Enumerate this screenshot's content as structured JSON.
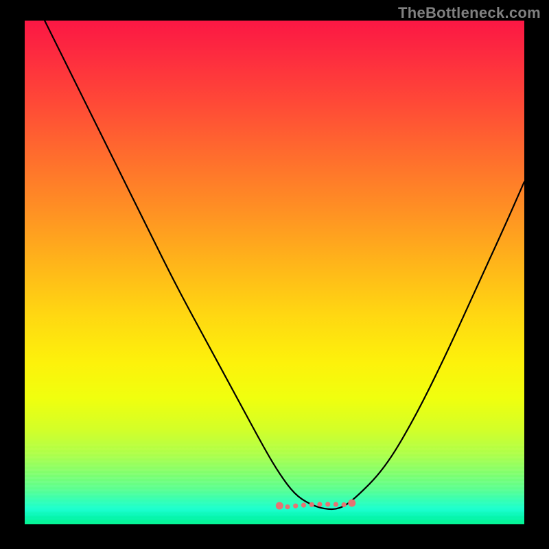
{
  "watermark": "TheBottleneck.com",
  "chart_data": {
    "type": "line",
    "title": "",
    "xlabel": "",
    "ylabel": "",
    "xlim": [
      0,
      100
    ],
    "ylim": [
      0,
      100
    ],
    "grid": false,
    "legend": false,
    "series": [
      {
        "name": "bottleneck-curve",
        "x": [
          0,
          6,
          12,
          18,
          24,
          30,
          36,
          42,
          48,
          51,
          54,
          57,
          60,
          63,
          66,
          72,
          78,
          84,
          90,
          96,
          100
        ],
        "values": [
          108,
          96,
          84,
          72,
          60,
          48,
          37,
          26,
          15,
          10,
          6,
          4,
          3,
          3,
          5,
          11,
          21,
          33,
          46,
          59,
          68
        ]
      }
    ],
    "annotations": [
      {
        "name": "valley-floor-marker",
        "x_range": [
          51,
          65.5
        ],
        "y": 3.4,
        "style": "dotted-salmon"
      }
    ],
    "background_gradient": {
      "top": "#fb1744",
      "mid": "#ffd612",
      "bottom": "#05f58f"
    }
  }
}
